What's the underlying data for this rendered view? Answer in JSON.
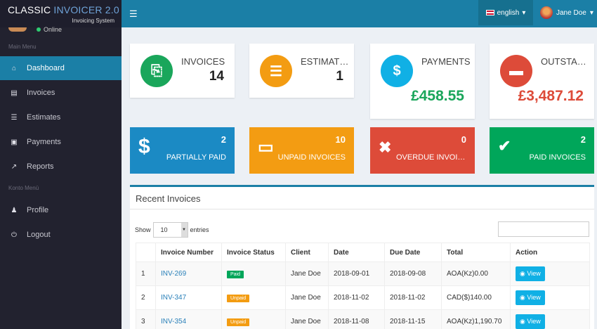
{
  "app": {
    "title_part1": "CLASSIC ",
    "title_part2": "INVOICER 2.0",
    "subtitle": "Invoicing System"
  },
  "topbar": {
    "menu_icon": "☰",
    "language": "english",
    "user_name": "Jane Doe"
  },
  "sidebar": {
    "status": "Online",
    "main_menu_label": "Main Menu",
    "account_menu_label": "Konto Menü",
    "items": [
      {
        "label": "Dashboard",
        "icon": "home-icon"
      },
      {
        "label": "Invoices",
        "icon": "file-pdf-icon"
      },
      {
        "label": "Estimates",
        "icon": "list-icon"
      },
      {
        "label": "Payments",
        "icon": "money-icon"
      },
      {
        "label": "Reports",
        "icon": "chart-icon"
      },
      {
        "label": "Profile",
        "icon": "user-icon"
      },
      {
        "label": "Logout",
        "icon": "power-icon"
      }
    ]
  },
  "summary": [
    {
      "label": "INVOICES",
      "value": "14",
      "color": "#1aa65b",
      "icon": "file-pdf-icon"
    },
    {
      "label": "ESTIMATES",
      "value": "1",
      "color": "#f39c12",
      "icon": "list-icon"
    },
    {
      "label": "PAYMENTS",
      "value": "£458.55",
      "color": "#10b0e5",
      "value_color": "#1aa65b",
      "icon": "dollar-icon"
    },
    {
      "label": "OUTSTANDING",
      "value": "£3,487.12",
      "color": "#dd4b39",
      "value_color": "#dd4b39",
      "icon": "credit-card-icon"
    }
  ],
  "status_tiles": [
    {
      "label": "PARTIALLY PAID",
      "count": "2",
      "color": "#1b8ac4",
      "icon": "$"
    },
    {
      "label": "UNPAID INVOICES",
      "count": "10",
      "color": "#f39c12",
      "icon": "▭"
    },
    {
      "label": "OVERDUE INVOICES",
      "count": "0",
      "color": "#dd4b39",
      "icon": "✖"
    },
    {
      "label": "PAID INVOICES",
      "count": "2",
      "color": "#00a65a",
      "icon": "✔"
    }
  ],
  "recent": {
    "title": "Recent Invoices",
    "show_label": "Show",
    "entries_value": "10",
    "entries_label": "entries",
    "columns": [
      "",
      "Invoice Number",
      "Invoice Status",
      "Client",
      "Date",
      "Due Date",
      "Total",
      "Action"
    ],
    "rows": [
      {
        "n": "1",
        "number": "INV-269",
        "status": "Paid",
        "status_color": "#00a65a",
        "client": "Jane Doe",
        "date": "2018-09-01",
        "due": "2018-09-08",
        "total": "AOA(Kz)0.00",
        "action": "View"
      },
      {
        "n": "2",
        "number": "INV-347",
        "status": "Unpaid",
        "status_color": "#f39c12",
        "client": "Jane Doe",
        "date": "2018-11-02",
        "due": "2018-11-02",
        "total": "CAD($)140.00",
        "action": "View"
      },
      {
        "n": "3",
        "number": "INV-354",
        "status": "Unpaid",
        "status_color": "#f39c12",
        "client": "Jane Doe",
        "date": "2018-11-08",
        "due": "2018-11-15",
        "total": "AOA(Kz)1,190.70",
        "action": "View"
      }
    ]
  }
}
